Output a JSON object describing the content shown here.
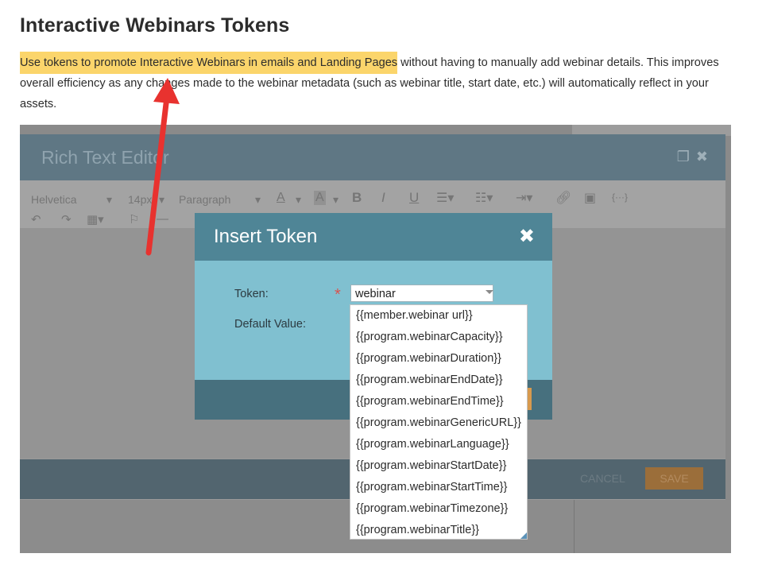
{
  "doc": {
    "title": "Interactive Webinars Tokens",
    "para_highlight": "Use tokens to promote Interactive Webinars in emails and Landing Pages",
    "para_rest": " without having to manually add webinar details. This improves overall efficiency as any changes made to the webinar metadata (such as webinar title, start date, etc.) will automatically reflect in your assets."
  },
  "editor": {
    "title": "Rich Text Editor",
    "font": "Helvetica",
    "size": "14px",
    "block": "Paragraph",
    "cancel_label": "CANCEL",
    "save_label": "SAVE"
  },
  "modal": {
    "title": "Insert Token",
    "close_glyph": "✖",
    "token_label": "Token:",
    "required_mark": "*",
    "default_label": "Default Value:",
    "token_value": "webinar"
  },
  "dropdown": {
    "items": [
      "{{member.webinar url}}",
      "{{program.webinarCapacity}}",
      "{{program.webinarDuration}}",
      "{{program.webinarEndDate}}",
      "{{program.webinarEndTime}}",
      "{{program.webinarGenericURL}}",
      "{{program.webinarLanguage}}",
      "{{program.webinarStartDate}}",
      "{{program.webinarStartTime}}",
      "{{program.webinarTimezone}}",
      "{{program.webinarTitle}}"
    ]
  },
  "colors": {
    "highlight": "#fbd56b",
    "arrow": "#e8322f",
    "modal_header": "#4f8596",
    "modal_body": "#80c0d0"
  }
}
